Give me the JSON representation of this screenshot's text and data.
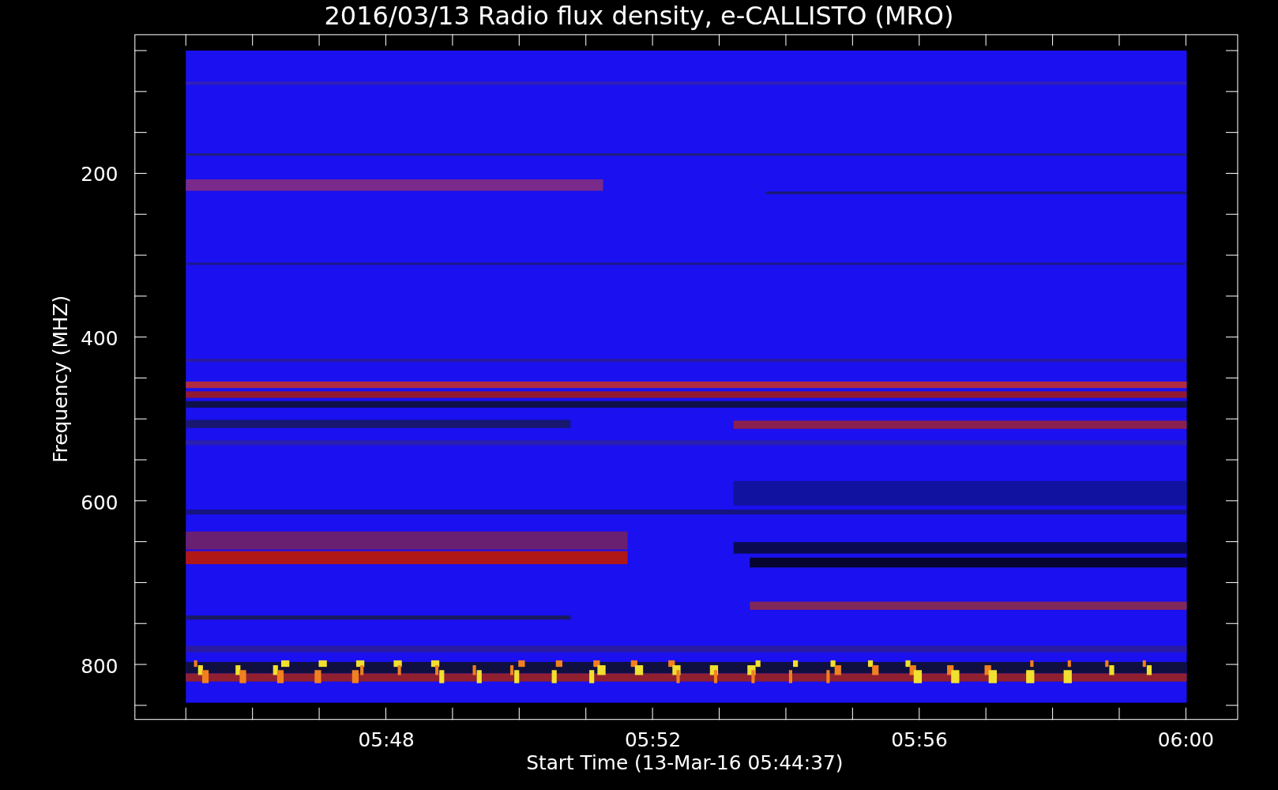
{
  "plot": {
    "title": "2016/03/13  Radio flux density, e-CALLISTO (MRO)",
    "ylabel": "Frequency (MHZ)",
    "xlabel": "Start Time (13-Mar-16 05:44:37)",
    "y_tick_labels": [
      "200",
      "400",
      "600",
      "800"
    ],
    "x_tick_labels": [
      "05:48",
      "05:52",
      "05:56",
      "06:00"
    ]
  }
}
